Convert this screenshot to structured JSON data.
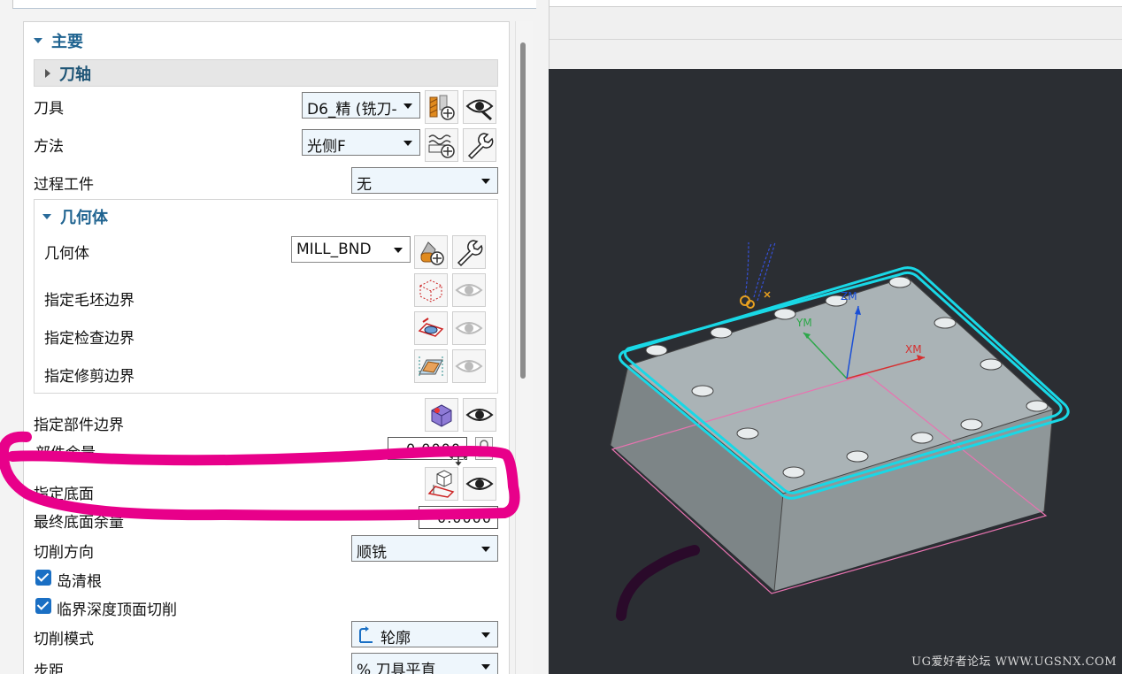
{
  "main_section": {
    "title": "主要"
  },
  "tool_axis_section": {
    "title": "刀轴"
  },
  "tool": {
    "label": "刀具",
    "value": "D6_精 (铣刀-"
  },
  "method": {
    "label": "方法",
    "value": "光侧F"
  },
  "in_process_workpiece": {
    "label": "过程工件",
    "value": "无"
  },
  "geometry_section": {
    "title": "几何体",
    "geometry": {
      "label": "几何体",
      "value": "MILL_BND"
    },
    "blank_boundary": {
      "label": "指定毛坯边界"
    },
    "check_boundary": {
      "label": "指定检查边界"
    },
    "trim_boundary": {
      "label": "指定修剪边界"
    }
  },
  "part_boundary": {
    "label": "指定部件边界"
  },
  "part_stock": {
    "label": "部件余量",
    "value": "0.0000"
  },
  "floor": {
    "label": "指定底面"
  },
  "final_floor_stock": {
    "label": "最终底面余量",
    "value": "0.0000"
  },
  "cut_direction": {
    "label": "切削方向",
    "value": "顺铣"
  },
  "island_cleanup": {
    "label": "岛清根",
    "checked": true
  },
  "critical_depth_top_cut": {
    "label": "临界深度顶面切削",
    "checked": true
  },
  "cut_pattern": {
    "label": "切削模式",
    "value": "轮廓"
  },
  "stepover": {
    "label": "步距",
    "value": "% 刀具平直"
  },
  "viewport": {
    "axis_xm": "XM",
    "axis_ym": "YM",
    "axis_zm": "ZM",
    "watermark": "UG爱好者论坛 WWW.UGSNX.COM"
  },
  "colors": {
    "accent": "#1f6390",
    "highlight_stroke": "#e8008a",
    "toolpath": "#19d8e6",
    "viewport_bg": "#2b2e33"
  }
}
